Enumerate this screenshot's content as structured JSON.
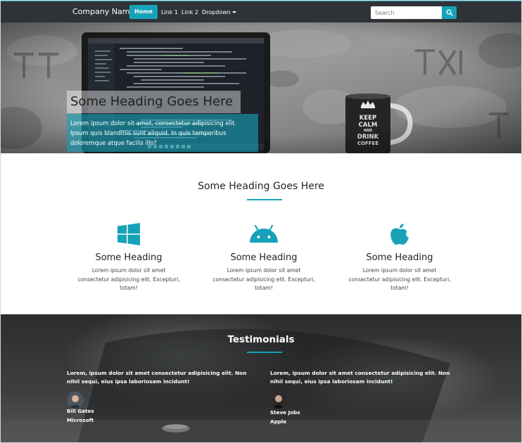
{
  "nav": {
    "brand": "Company Name",
    "home": "Home",
    "link1": "Link 1",
    "link2": "Link 2",
    "dropdown": "Dropdown",
    "search_placeholder": "Search"
  },
  "hero": {
    "heading": "Some Heading Goes Here",
    "text": "Lorem ipsum dolor sit amet, consectetur adipisicing elit. Ipsum quis blanditiis sunt aliquid. In quis temporibus doloremque atque facilis illo?",
    "mug_text": [
      "KEEP",
      "CALM",
      "AND",
      "DRINK",
      "COFFEE"
    ]
  },
  "features": {
    "title": "Some Heading Goes Here",
    "items": [
      {
        "icon": "windows-icon",
        "heading": "Some Heading",
        "text": "Lorem ipsum dolor sit amet consectetur adipisicing elit. Excepturi, totam!"
      },
      {
        "icon": "android-icon",
        "heading": "Some Heading",
        "text": "Lorem ipsum dolor sit amet consectetur adipisicing elit. Excepturi, totam!"
      },
      {
        "icon": "apple-icon",
        "heading": "Some Heading",
        "text": "Lorem ipsum dolor sit amet consectetur adipisicing elit. Excepturi, totam!"
      }
    ]
  },
  "testimonials": {
    "title": "Testimonials",
    "items": [
      {
        "quote": "Lorem, ipsum dolor sit amet consectetur adipisicing elit. Non nihil sequi, eius ipsa laboriosam incidunt!",
        "name": "Bill Gates",
        "company": "Microsoft"
      },
      {
        "quote": "Lorem, ipsum dolor sit amet consectetur adipisicing elit. Non nihil sequi, eius ipsa laboriosam incidunt!",
        "name": "Steve Jobs",
        "company": "Apple"
      }
    ]
  },
  "colors": {
    "accent": "#17a2b8",
    "navbar": "#2f3338"
  }
}
